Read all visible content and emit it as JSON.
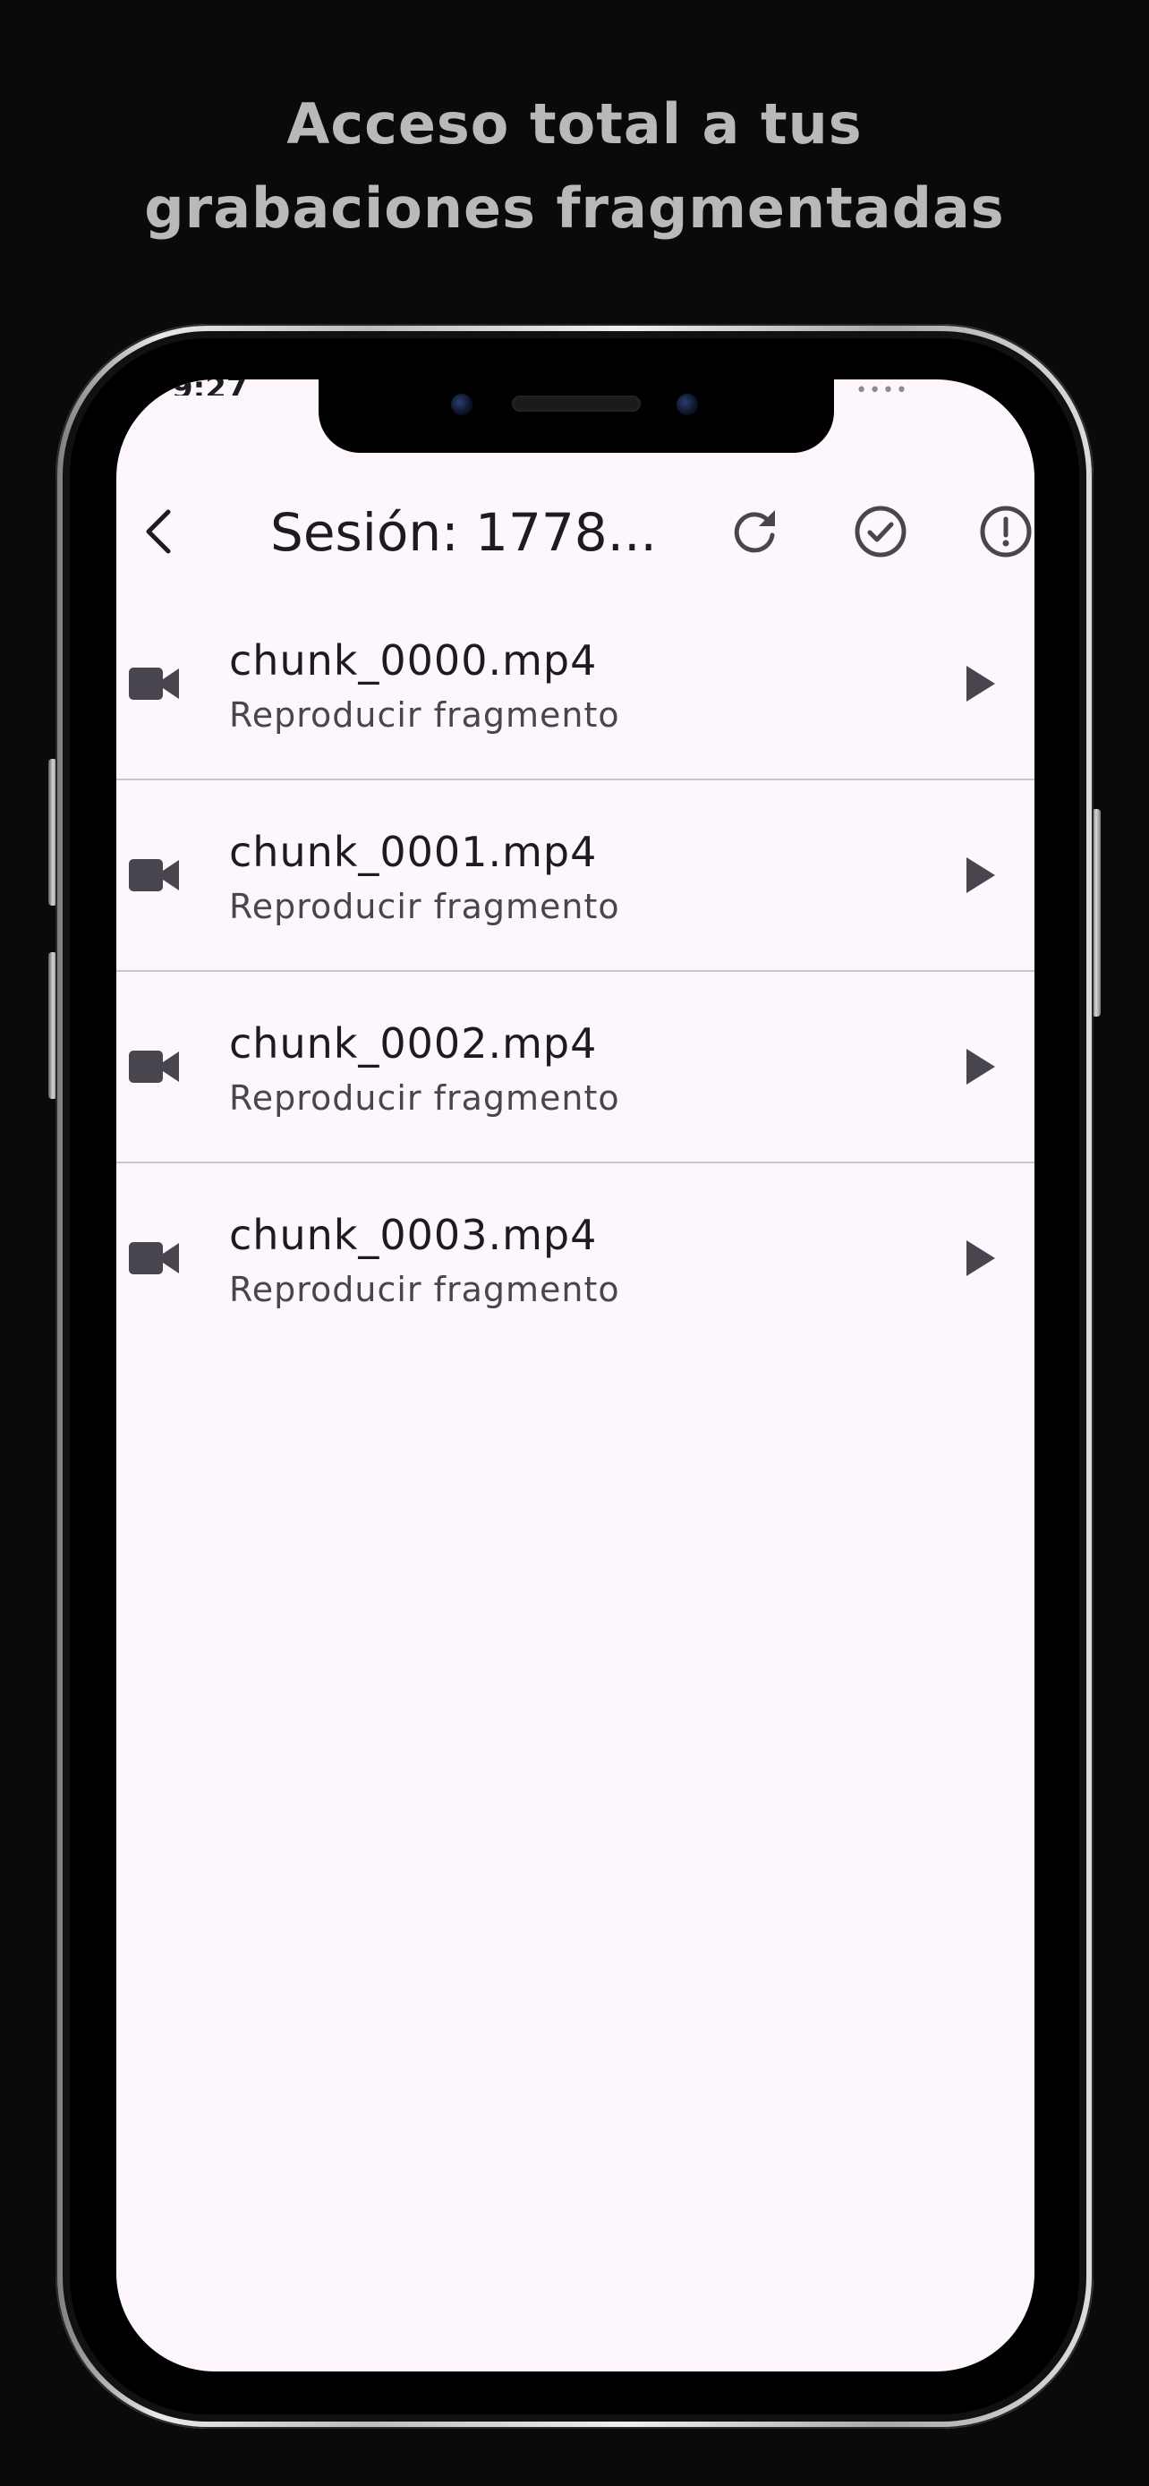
{
  "promo": {
    "line1": "Acceso total a tus",
    "line2": "grabaciones fragmentadas"
  },
  "status_bar": {
    "time": "9:27",
    "signal": "••••"
  },
  "appbar": {
    "title": "Sesión: 1778...",
    "back_icon": "chevron-left-icon",
    "actions": [
      {
        "name": "refresh-icon"
      },
      {
        "name": "check-circle-icon"
      },
      {
        "name": "error-circle-icon"
      }
    ]
  },
  "colors": {
    "background": "#0a0a0a",
    "screen": "#fdf7fd",
    "text_primary": "#1c1b1f",
    "text_secondary": "#49454f",
    "divider": "#cac4d0",
    "icon": "#49454f"
  },
  "chunks": [
    {
      "filename": "chunk_0000.mp4",
      "subtitle": "Reproducir fragmento"
    },
    {
      "filename": "chunk_0001.mp4",
      "subtitle": "Reproducir fragmento"
    },
    {
      "filename": "chunk_0002.mp4",
      "subtitle": "Reproducir fragmento"
    },
    {
      "filename": "chunk_0003.mp4",
      "subtitle": "Reproducir fragmento"
    }
  ]
}
